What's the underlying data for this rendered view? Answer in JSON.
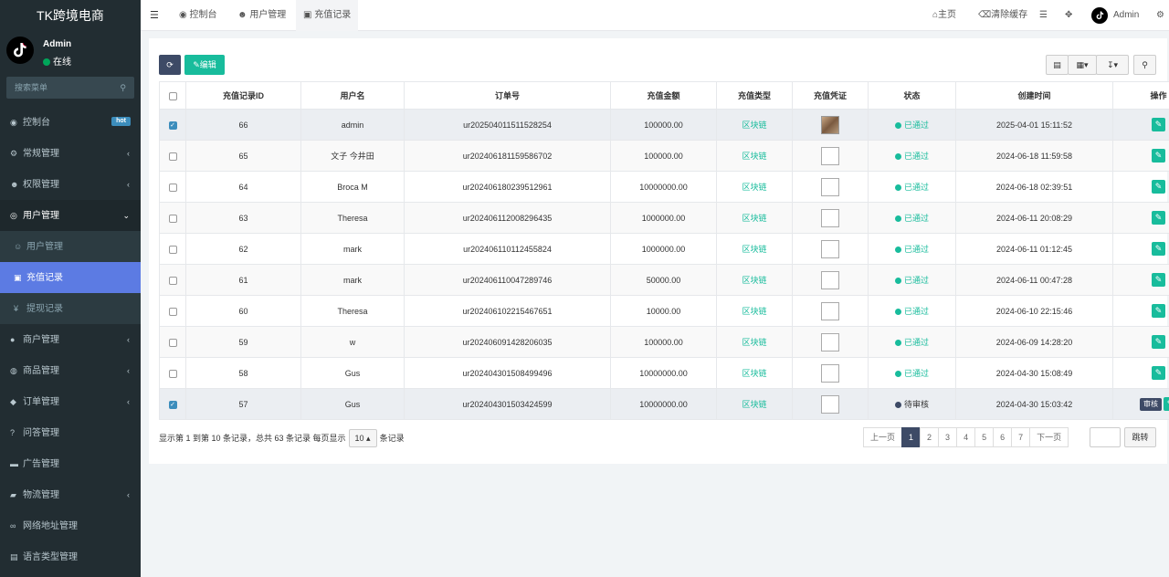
{
  "brand": "TK跨境电商",
  "user": {
    "name": "Admin",
    "status": "在线"
  },
  "menu_search": {
    "placeholder": "搜索菜单"
  },
  "menu": [
    {
      "label": "控制台",
      "icon": "dashboard-icon",
      "badge": "hot"
    },
    {
      "label": "常规管理",
      "icon": "cogs-icon",
      "arrow": "‹"
    },
    {
      "label": "权限管理",
      "icon": "group-icon",
      "arrow": "‹"
    },
    {
      "label": "用户管理",
      "icon": "user-circle-icon",
      "arrow": "⌄",
      "open": true
    },
    {
      "label": "用户管理",
      "icon": "user-icon",
      "sub": true
    },
    {
      "label": "充值记录",
      "icon": "money-icon",
      "sub": true,
      "active": true
    },
    {
      "label": "提现记录",
      "icon": "yen-icon",
      "sub": true
    },
    {
      "label": "商户管理",
      "icon": "apple-icon",
      "arrow": "‹"
    },
    {
      "label": "商品管理",
      "icon": "product-icon",
      "arrow": "‹"
    },
    {
      "label": "订单管理",
      "icon": "cube-icon",
      "arrow": "‹"
    },
    {
      "label": "问答管理",
      "icon": "question-icon"
    },
    {
      "label": "广告管理",
      "icon": "ad-icon"
    },
    {
      "label": "物流管理",
      "icon": "truck-icon",
      "arrow": "‹"
    },
    {
      "label": "网络地址管理",
      "icon": "link-icon"
    },
    {
      "label": "语言类型管理",
      "icon": "language-icon"
    }
  ],
  "topbar": {
    "tabs": [
      {
        "label": "控制台",
        "icon": "dashboard-icon"
      },
      {
        "label": "用户管理",
        "icon": "user-icon"
      },
      {
        "label": "充值记录",
        "icon": "money-icon"
      }
    ],
    "home": "主页",
    "clear_cache": "清除缓存",
    "admin": "Admin"
  },
  "toolbar": {
    "edit": "编辑"
  },
  "table": {
    "headers": [
      "充值记录ID",
      "用户名",
      "订单号",
      "充值金额",
      "充值类型",
      "充值凭证",
      "状态",
      "创建时间",
      "操作"
    ],
    "rows": [
      {
        "id": "66",
        "user": "admin",
        "order": "ur202504011511528254",
        "amount": "100000.00",
        "type": "区块链",
        "status": "已通过",
        "time": "2025-04-01 15:11:52",
        "checked": true,
        "photo": true
      },
      {
        "id": "65",
        "user": "文子 今井田",
        "order": "ur202406181159586702",
        "amount": "100000.00",
        "type": "区块链",
        "status": "已通过",
        "time": "2024-06-18 11:59:58"
      },
      {
        "id": "64",
        "user": "Broca M",
        "order": "ur202406180239512961",
        "amount": "10000000.00",
        "type": "区块链",
        "status": "已通过",
        "time": "2024-06-18 02:39:51"
      },
      {
        "id": "63",
        "user": "Theresa",
        "order": "ur202406112008296435",
        "amount": "1000000.00",
        "type": "区块链",
        "status": "已通过",
        "time": "2024-06-11 20:08:29"
      },
      {
        "id": "62",
        "user": "mark",
        "order": "ur202406110112455824",
        "amount": "1000000.00",
        "type": "区块链",
        "status": "已通过",
        "time": "2024-06-11 01:12:45"
      },
      {
        "id": "61",
        "user": "mark",
        "order": "ur202406110047289746",
        "amount": "50000.00",
        "type": "区块链",
        "status": "已通过",
        "time": "2024-06-11 00:47:28"
      },
      {
        "id": "60",
        "user": "Theresa",
        "order": "ur202406102215467651",
        "amount": "10000.00",
        "type": "区块链",
        "status": "已通过",
        "time": "2024-06-10 22:15:46"
      },
      {
        "id": "59",
        "user": "w",
        "order": "ur202406091428206035",
        "amount": "100000.00",
        "type": "区块链",
        "status": "已通过",
        "time": "2024-06-09 14:28:20"
      },
      {
        "id": "58",
        "user": "Gus",
        "order": "ur202404301508499496",
        "amount": "10000000.00",
        "type": "区块链",
        "status": "已通过",
        "time": "2024-04-30 15:08:49"
      },
      {
        "id": "57",
        "user": "Gus",
        "order": "ur202404301503424599",
        "amount": "10000000.00",
        "type": "区块链",
        "status": "待审核",
        "time": "2024-04-30 15:03:42",
        "checked": true,
        "review": "审核"
      }
    ]
  },
  "pager": {
    "info_before": "显示第 1 到第 10 条记录，总共 63 条记录 每页显示",
    "page_size": "10 ▴",
    "info_after": "条记录",
    "prev": "上一页",
    "pages": [
      "1",
      "2",
      "3",
      "4",
      "5",
      "6",
      "7"
    ],
    "next": "下一页",
    "jump": "跳转"
  }
}
